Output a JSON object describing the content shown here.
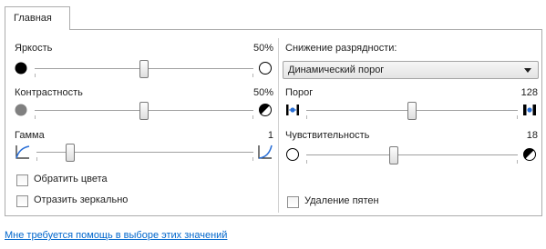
{
  "tab": {
    "label": "Главная"
  },
  "left": {
    "brightness": {
      "label": "Яркость",
      "value": "50%",
      "level": 50
    },
    "contrast": {
      "label": "Контрастность",
      "value": "50%",
      "level": 50
    },
    "gamma": {
      "label": "Гамма",
      "value": "1",
      "level": 10
    },
    "invert_colors": {
      "label": "Обратить цвета",
      "checked": false
    },
    "mirror": {
      "label": "Отразить зеркально",
      "checked": false
    }
  },
  "right": {
    "bit_depth_label": "Снижение разрядности:",
    "bit_depth_select": {
      "selected": "Динамический порог"
    },
    "threshold": {
      "label": "Порог",
      "value": "128",
      "level": 50
    },
    "sensitivity": {
      "label": "Чувствительность",
      "value": "18",
      "level": 40
    },
    "despeckle": {
      "label": "Удаление пятен",
      "checked": false
    }
  },
  "help_link": "Мне требуется помощь в выборе этих значений",
  "icons": [
    "black-circle-icon",
    "white-circle-icon",
    "gray-circle-icon",
    "half-circle-icon",
    "gamma-curve-icon",
    "gamma-curve-high-icon",
    "threshold-low-icon",
    "threshold-high-icon"
  ]
}
